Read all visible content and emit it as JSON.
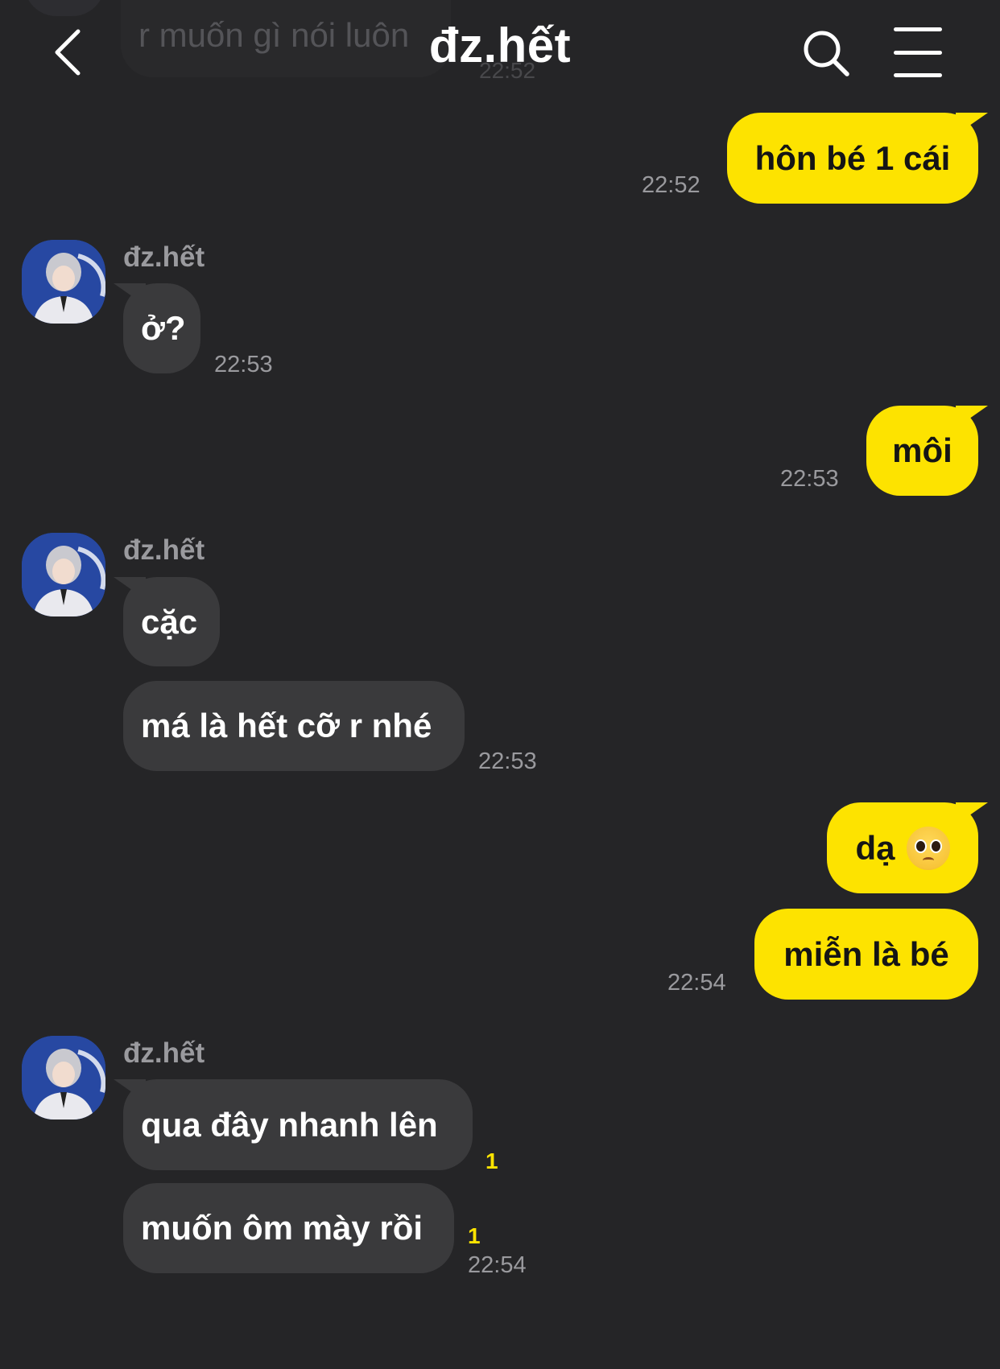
{
  "header": {
    "title": "đz.hết",
    "previous_message_preview": "r muốn gì nói luôn",
    "previous_message_time": "22:52"
  },
  "contact": {
    "name": "đz.hết"
  },
  "colors": {
    "background": "#252527",
    "my_bubble": "#fde300",
    "their_bubble": "#3a3a3c",
    "timestamp": "#9a9a9e",
    "unread_count": "#fde300"
  },
  "messages": [
    {
      "id": "m1",
      "from": "me",
      "text": "hôn bé 1 cái",
      "time": "22:52"
    },
    {
      "id": "m2",
      "from": "them",
      "sender": "đz.hết",
      "text": "ở?",
      "time": "22:53"
    },
    {
      "id": "m3",
      "from": "me",
      "text": "môi",
      "time": "22:53"
    },
    {
      "id": "m4",
      "from": "them",
      "sender": "đz.hết",
      "text": "cặc"
    },
    {
      "id": "m5",
      "from": "them",
      "text": "má là hết cỡ r nhé",
      "time": "22:53"
    },
    {
      "id": "m6",
      "from": "me",
      "text": "dạ",
      "emoji": "pleading-face"
    },
    {
      "id": "m7",
      "from": "me",
      "text": "miễn là bé",
      "time": "22:54"
    },
    {
      "id": "m8",
      "from": "them",
      "sender": "đz.hết",
      "text": "qua đây nhanh lên",
      "unread": "1"
    },
    {
      "id": "m9",
      "from": "them",
      "text": "muốn ôm mày rồi",
      "unread": "1",
      "time": "22:54"
    }
  ],
  "icons": {
    "back": "chevron-left-icon",
    "search": "search-icon",
    "menu": "hamburger-menu-icon"
  }
}
